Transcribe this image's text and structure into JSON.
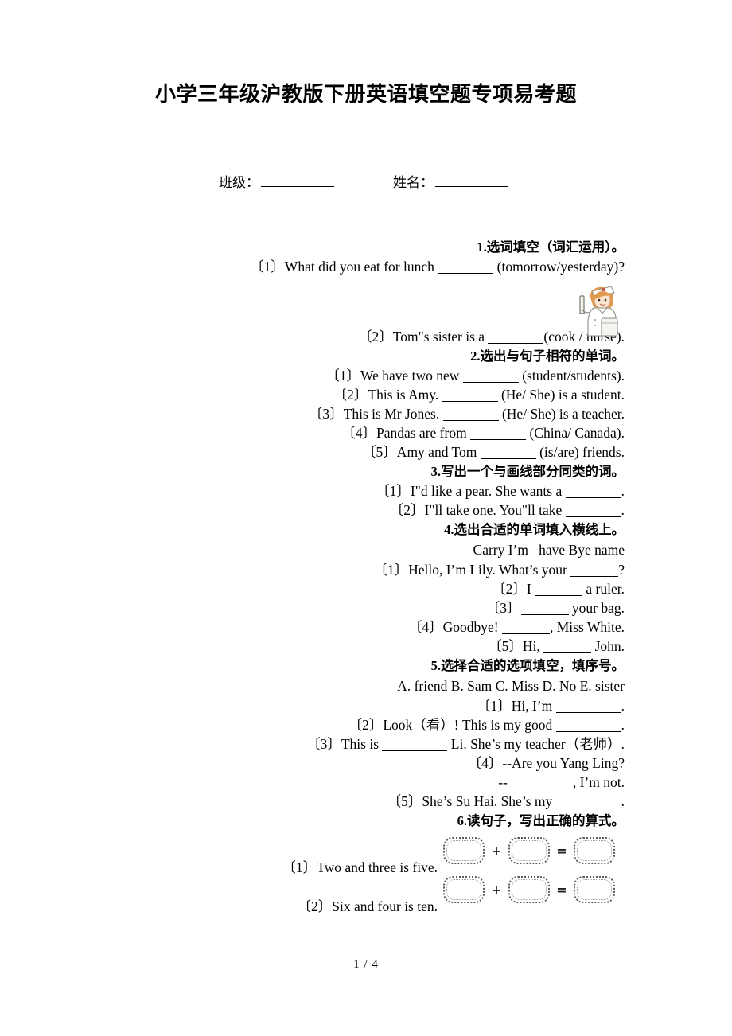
{
  "document": {
    "title": "小学三年级沪教版下册英语填空题专项易考题",
    "footer_page": "1 / 4"
  },
  "meta": {
    "class_label": "班级：",
    "name_label": "姓名："
  },
  "sections": [
    {
      "heading_num": "1.",
      "heading_text": "选词填空（词汇运用）。",
      "items": [
        "〔1〕What did you eat for lunch ________ (tomorrow/yesterday)?",
        "〔2〕Tom\"s sister is a ________(cook / nurse)."
      ],
      "illustration": "nurse-illustration"
    },
    {
      "heading_num": "2.",
      "heading_text": "选出与句子相符的单词。",
      "items": [
        "〔1〕We have two new ________ (student/students).",
        "〔2〕This is Amy. ________ (He/ She) is a student.",
        "〔3〕This is Mr Jones. ________ (He/ She) is a teacher.",
        "〔4〕Pandas are from ________ (China/ Canada).",
        "〔5〕Amy and Tom ________ (is/are) friends."
      ]
    },
    {
      "heading_num": "3.",
      "heading_text": "写出一个与画线部分同类的词。",
      "items": [
        "〔1〕I\"d like a pear. She wants a ________.",
        "〔2〕I\"ll take one. You\"ll take ________."
      ]
    },
    {
      "heading_num": "4.",
      "heading_text": "选出合适的单词填入横线上。",
      "word_bank": "Carry I’m   have Bye name",
      "items": [
        "〔1〕Hello, I’m Lily. What’s your ______?",
        "〔2〕I ______ a ruler.",
        "〔3〕______ your bag.",
        "〔4〕Goodbye! ______, Miss White.",
        "〔5〕Hi, ______ John."
      ]
    },
    {
      "heading_num": "5.",
      "heading_text": "选择合适的选项填空，填序号。",
      "options_line": "A. friend B. Sam C. Miss D. No E. sister",
      "items": [
        "〔1〕Hi, I’m _________.",
        "〔2〕Look（看）! This is my good _________.",
        "〔3〕This is _________ Li. She’s my teacher（老师）.",
        "〔4〕--Are you Yang Ling?",
        "--_________, I’m not.",
        "〔5〕She’s Su Hai. She’s my _________."
      ]
    },
    {
      "heading_num": "6.",
      "heading_text": "读句子，写出正确的算式。",
      "items": [
        "〔1〕Two and three is five.",
        "〔2〕Six and four is ten."
      ],
      "equation_rows": [
        {
          "op1": "+",
          "op2": "="
        },
        {
          "op1": "+",
          "op2": "="
        }
      ]
    }
  ],
  "s1": {
    "head_num": "1.",
    "head_text": "选词填空（词汇运用）。",
    "q1a": "〔1〕What did you eat for lunch",
    "q1b": "(tomorrow/yesterday)?",
    "q2a": "〔2〕Tom\"s sister is a",
    "q2b": "(cook / nurse)."
  },
  "s2": {
    "head_num": "2.",
    "head_text": "选出与句子相符的单词。",
    "q1a": "〔1〕We have two new",
    "q1b": "(student/students).",
    "q2a": "〔2〕This is Amy.",
    "q2b": "(He/ She) is a student.",
    "q3a": "〔3〕This is Mr Jones.",
    "q3b": "(He/ She) is a teacher.",
    "q4a": "〔4〕Pandas are from",
    "q4b": "(China/ Canada).",
    "q5a": "〔5〕Amy and Tom",
    "q5b": "(is/are) friends."
  },
  "s3": {
    "head_num": "3.",
    "head_text": "写出一个与画线部分同类的词。",
    "q1a": "〔1〕I\"d like a pear. She wants a",
    "q1b": ".",
    "q2a": "〔2〕I\"ll take one. You\"ll take",
    "q2b": "."
  },
  "s4": {
    "head_num": "4.",
    "head_text": "选出合适的单词填入横线上。",
    "bank": "Carry I’m   have Bye name",
    "q1a": "〔1〕Hello, I’m Lily. What’s your",
    "q1b": "?",
    "q2a": "〔2〕I",
    "q2b": "a ruler.",
    "q3a": "〔3〕",
    "q3b": "your bag.",
    "q4a": "〔4〕Goodbye!",
    "q4b": ", Miss White.",
    "q5a": "〔5〕Hi,",
    "q5b": "John."
  },
  "s5": {
    "head_num": "5.",
    "head_text": "选择合适的选项填空，填序号。",
    "options": "A. friend B. Sam C. Miss D. No E. sister",
    "q1a": "〔1〕Hi, I’m",
    "q1b": ".",
    "q2a": "〔2〕Look（看）! This is my good",
    "q2b": ".",
    "q3a": "〔3〕This is",
    "q3b": "Li. She’s my teacher（老师）.",
    "q4": "〔4〕--Are you Yang Ling?",
    "q4ba": "--",
    "q4bb": ", I’m not.",
    "q5a": "〔5〕She’s Su Hai. She’s my",
    "q5b": "."
  },
  "s6": {
    "head_num": "6.",
    "head_text": "读句子，写出正确的算式。",
    "q1": "〔1〕Two and three is five.",
    "q2": "〔2〕Six and four is ten.",
    "plus": "+",
    "equals": "="
  }
}
